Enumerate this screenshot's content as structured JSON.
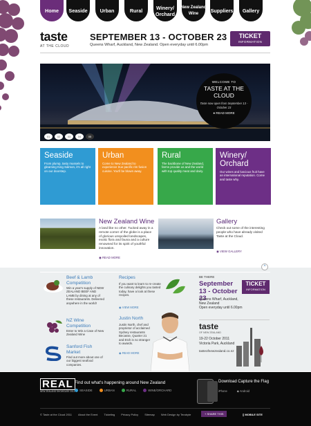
{
  "nav": {
    "items": [
      "Home",
      "Seaside",
      "Urban",
      "Rural",
      "Winery/\nOrchard",
      "New Zealand\nWine",
      "Suppliers",
      "Gallery"
    ]
  },
  "header": {
    "logo_main": "taste",
    "logo_sub": "AT THE CLOUD",
    "date": "SEPTEMBER 13 - OCTOBER 23",
    "location": "Queens Wharf, Auckland, New Zealand. Open everyday until 6.00pm",
    "ticket_label": "TICKET",
    "ticket_sub": "INFORMATION"
  },
  "hero": {
    "welcome_small": "WELCOME TO",
    "welcome_title": "TASTE AT THE CLOUD",
    "welcome_text": "Taste now open from September 13 - October 23",
    "read_more": "READ MORE",
    "slides": [
      "01",
      "02",
      "03",
      "04",
      "05"
    ],
    "current_slide": "05"
  },
  "tiles": [
    {
      "title": "Seaside",
      "text": "From plump, tasty mussels to gleaming King Salmon, it's all right on our doorstep.",
      "color": "#2f9bd3"
    },
    {
      "title": "Urban",
      "text": "Come to New Zealand to experience true pacific rim fusion cuisine. You'll be blown away.",
      "color": "#f28f1e"
    },
    {
      "title": "Rural",
      "text": "The backbone of New Zealand, farms provide us and the world with top quality meat and dairy.",
      "color": "#37a84a"
    },
    {
      "title": "Winery/ Orchard",
      "text": "Our wines and luscious fruit have an international reputation. Come and taste why.",
      "color": "#6d2f86"
    }
  ],
  "wine": {
    "title": "New Zealand Wine",
    "text": "A land like no other. Tucked away in a remote corner of the globe is a place of glorious unspoiled landscapes, exotic flora and fauna and a culture renowned for its spirit of youthful innovation.",
    "more": "READ MORE"
  },
  "gallery": {
    "title": "Gallery",
    "text": "Check out some of the interesting people who have already visited Taste at the Cloud.",
    "more": "VIEW GALLERY"
  },
  "lower": {
    "lamb": {
      "title": "Beef & Lamb Competition",
      "text": "Win a year's supply of NEW ZEALAND BEEF AND LAMB by dining at any of these restaurants. Delivered anywhere in the world!"
    },
    "wine_comp": {
      "title": "NZ Wine Competition",
      "text": "Enter to Win a Case of New Zealand Wine"
    },
    "sanford": {
      "title": "Sanford Fish Market",
      "text": "Find out more about one of our biggest seafood companies."
    },
    "recipes": {
      "title": "Recipes",
      "text": "If you want to learn to re-create the culinary delights you tasted today, have a look at these recipes.",
      "more": "VIEW MORE"
    },
    "justin": {
      "title": "Justin North",
      "text": "Justin North, chef and proprietor of acclaimed Sydney restaurants Becasse, Quarter 21 and Etch is no stranger to awards.",
      "more": "READ MORE"
    },
    "be_there": {
      "label": "BE THERE",
      "date": "September 13 - October 23",
      "loc": "Queens Wharf, Auckland, New Zealand",
      "open": "Open everyday until 6.00pm",
      "ticket_label": "TICKET",
      "ticket_sub": "INFORMATION",
      "logo": "taste",
      "logo_sub": "OF NEW ZEALAND",
      "date2": "19-22 October 2011",
      "venue": "Victoria Park, Auckland",
      "url": "tasteofnewzealand.co.nz"
    }
  },
  "footer": {
    "real": "REAL",
    "real_sub": "NEW ZEALAND SHOWCASE 2011",
    "find": "Find out what's happening around New Zealand",
    "links": [
      {
        "label": "SEASIDE",
        "color": "#2f9bd3"
      },
      {
        "label": "URBAN",
        "color": "#f28f1e"
      },
      {
        "label": "RURAL",
        "color": "#37a84a"
      },
      {
        "label": "WINE/ORCHARD",
        "color": "#6d2f86"
      }
    ],
    "download": "Download Capture the Flag",
    "iphone": "iPhone",
    "android": "Android",
    "nav": [
      "© Taste at the Cloud 2011",
      "About the Event",
      "Ticketing",
      "Privacy Policy",
      "Sitemap",
      "Web Design by Terabyte"
    ],
    "share": "+ SHARE THIS",
    "mobile": "MOBILE SITE"
  }
}
